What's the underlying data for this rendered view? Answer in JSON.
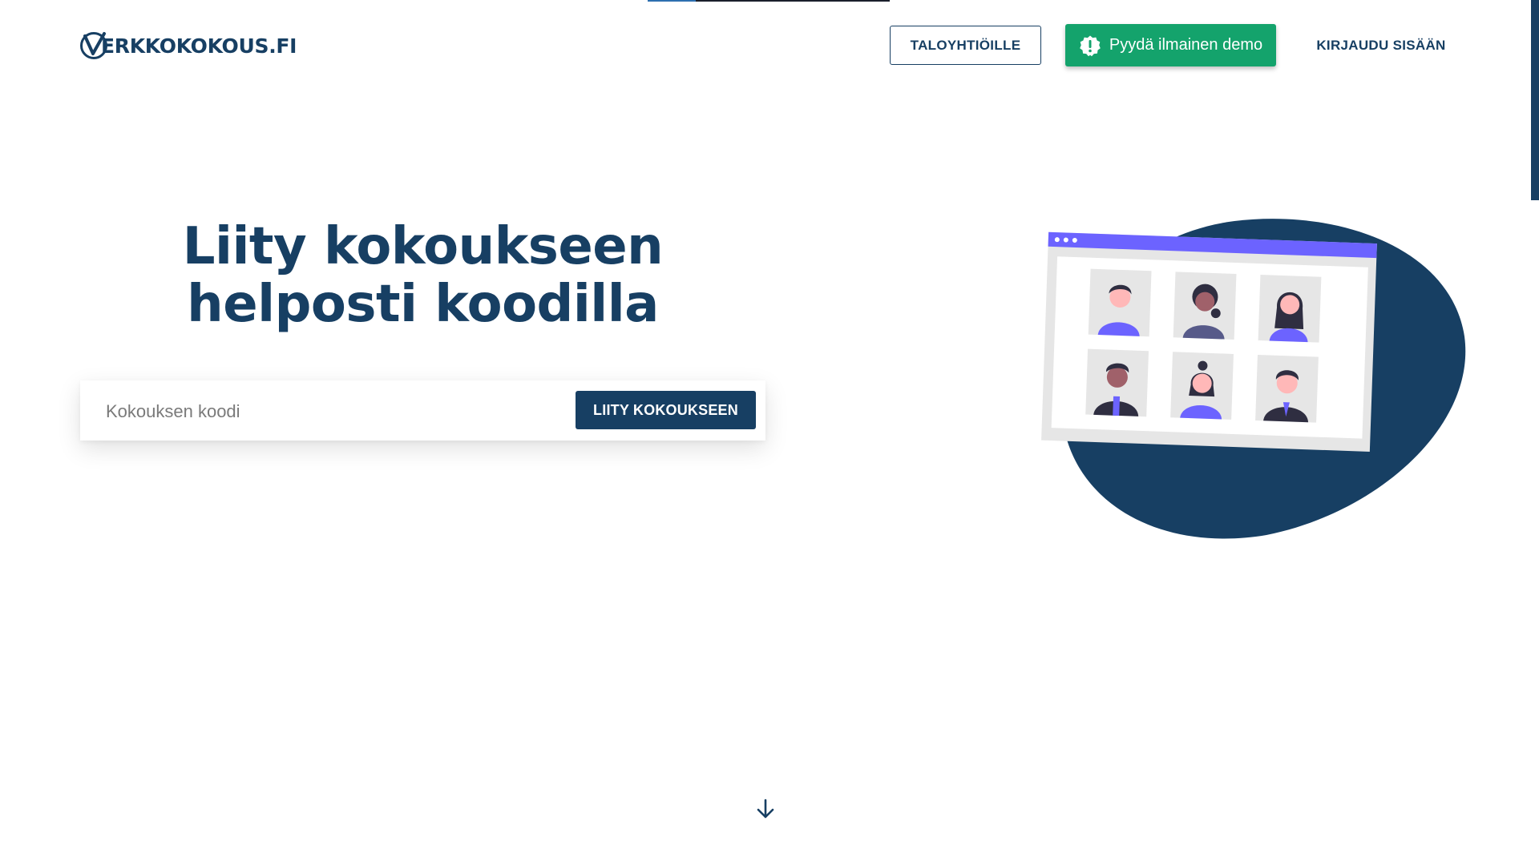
{
  "header": {
    "logo_text": "ERKKOKOKOUS.FI",
    "logo_mark": "check-circle-V",
    "nav_housing_label": "TALOYHTIÖILLE",
    "demo_label": "Pyydä ilmainen demo",
    "login_label": "KIRJAUDU SISÄÄN"
  },
  "hero": {
    "title": "Liity kokoukseen helposti koodilla",
    "code_placeholder": "Kokouksen koodi",
    "join_button_label": "LIITY KOKOUKSEEN"
  },
  "page_progress": 0.2,
  "colors": {
    "navy": "#173f63",
    "green": "#14a36c",
    "accent_purple": "#6c63ff",
    "panel_gray": "#e6e6e6"
  },
  "icons": {
    "demo": "alert-badge-icon",
    "scroll": "arrow-down-icon"
  }
}
